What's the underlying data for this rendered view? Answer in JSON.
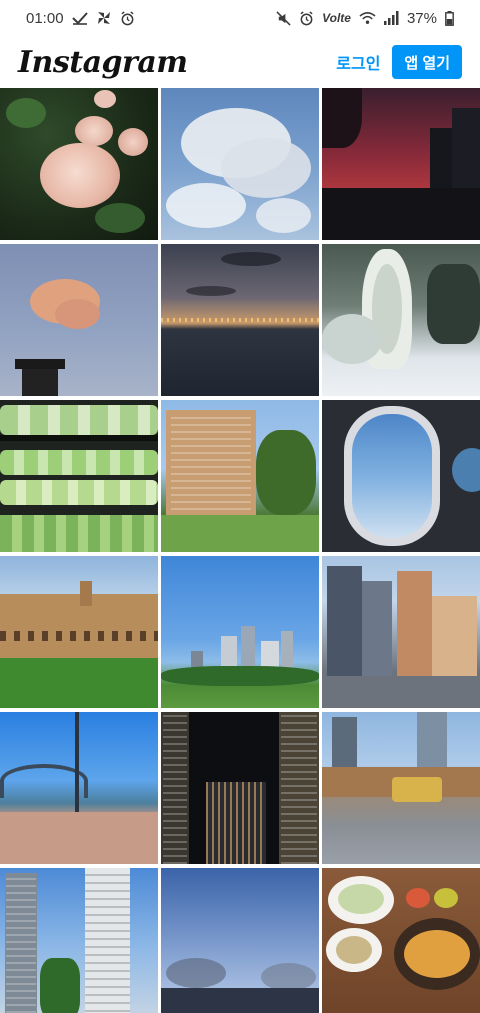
{
  "status_bar": {
    "time": "01:00",
    "battery": "37%",
    "network": "Volte",
    "left_icons": [
      "check-icon",
      "pinwheel-icon",
      "alarm-icon"
    ],
    "right_icons": [
      "mute-icon",
      "alarm-icon",
      "wifi-icon",
      "signal-icon",
      "battery-icon"
    ]
  },
  "header": {
    "logo": "Instagram",
    "login_label": "로그인",
    "open_app_label": "앱 열기"
  },
  "colors": {
    "accent": "#0095f6"
  },
  "grid": {
    "tiles": [
      "roses",
      "clouds",
      "red-sunset-skyline",
      "pink-cloud-chimney",
      "dusk-lake",
      "snowy-trees",
      "vegetable-shelves",
      "apartment-building",
      "airplane-window",
      "sandstone-university",
      "city-park-skyline",
      "city-street-tram",
      "harbour-bridge",
      "night-towers",
      "tram-street",
      "tall-towers",
      "blue-sky",
      "food-table"
    ]
  }
}
